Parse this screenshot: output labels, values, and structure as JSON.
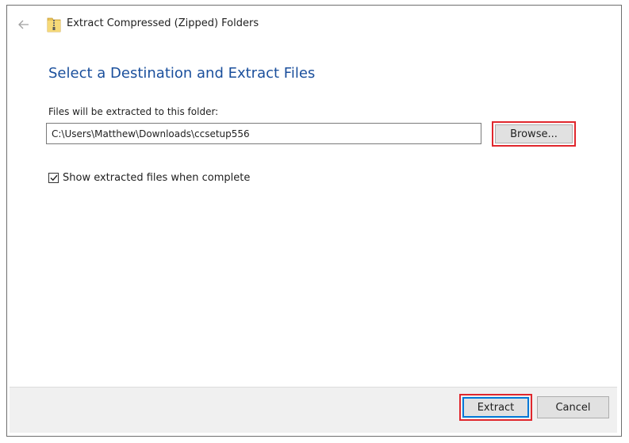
{
  "window": {
    "title": "Extract Compressed (Zipped) Folders"
  },
  "icons": {
    "back": "back-arrow-icon",
    "zip": "zip-folder-icon",
    "check": "checkmark-icon"
  },
  "colors": {
    "heading": "#1a4f9c",
    "highlight": "#e0272d",
    "default_button_accent": "#0078d7",
    "footer_bg": "#f0f0f0"
  },
  "main": {
    "heading": "Select a Destination and Extract Files",
    "folder_label": "Files will be extracted to this folder:",
    "path_value": "C:\\Users\\Matthew\\Downloads\\ccsetup556",
    "browse_label": "Browse...",
    "show_files_label": "Show extracted files when complete",
    "show_files_checked": true
  },
  "footer": {
    "extract_label": "Extract",
    "cancel_label": "Cancel"
  }
}
